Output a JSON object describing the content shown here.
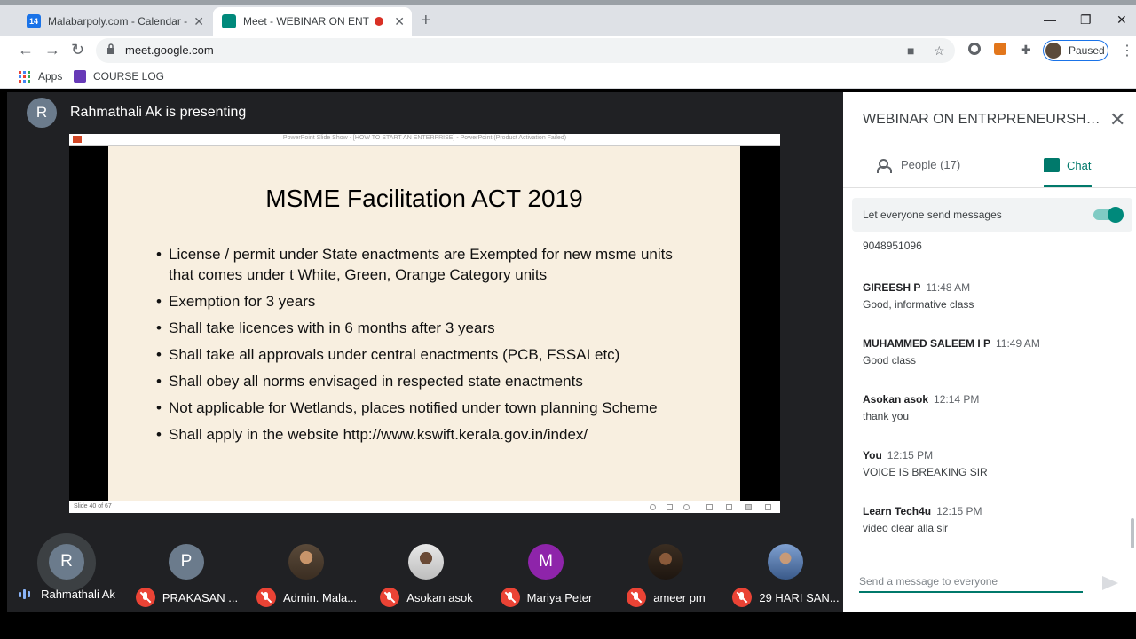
{
  "browser": {
    "tabs": [
      {
        "title": "Malabarpoly.com - Calendar - Sa",
        "favicon_text": "14",
        "favicon_color": "#1a73e8"
      },
      {
        "title": "Meet - WEBINAR ON ENTRP",
        "favicon_color": "#00897b",
        "recording_color": "#d93025"
      }
    ],
    "url": "meet.google.com",
    "profile_status": "Paused",
    "bookmarks": [
      {
        "label": "Apps"
      },
      {
        "label": "COURSE LOG"
      }
    ]
  },
  "meet": {
    "presenter_initial": "R",
    "presenter_text": "Rahmathali Ak is presenting",
    "slide": {
      "title": "MSME Facilitation ACT 2019",
      "bullets": [
        "License / permit under State enactments are Exempted for new msme units that comes under t White, Green, Orange Category units",
        "Exemption for 3 years",
        "Shall take licences with in 6 months after 3 years",
        "Shall take all approvals under central enactments (PCB, FSSAI etc)",
        "Shall obey all norms envisaged in respected state enactments",
        "Not applicable for Wetlands, places notified under town planning Scheme",
        "Shall apply in the website http://www.kswift.kerala.gov.in/index/"
      ],
      "ppt_window_title": "PowerPoint Slide Show - [HOW TO START AN ENTERPRISE] - PowerPoint (Product Activation Failed)",
      "slide_number": "Slide 40 of 67"
    },
    "participants": [
      {
        "initial": "R",
        "name": "Rahmathali Ak",
        "color": "#6b7b8c",
        "speaking": true
      },
      {
        "initial": "P",
        "name": "PRAKASAN ...",
        "color": "#6b7b8c"
      },
      {
        "initial": "",
        "name": "Admin. Mala...",
        "color": "#b5563d"
      },
      {
        "initial": "",
        "name": "Asokan asok",
        "color": "#8a8a8a"
      },
      {
        "initial": "M",
        "name": "Mariya Peter",
        "color": "#8e24aa"
      },
      {
        "initial": "",
        "name": "ameer pm",
        "color": "#3b2e22"
      },
      {
        "initial": "",
        "name": "29 HARI SAN...",
        "color": "#4a6a9a"
      }
    ]
  },
  "panel": {
    "title": "WEBINAR ON ENTRPRENEURSHIP...",
    "people_tab": "People (17)",
    "chat_tab": "Chat",
    "toggle_label": "Let everyone send messages",
    "messages": [
      {
        "sender": "",
        "time": "",
        "text": "9048951096"
      },
      {
        "sender": "GIREESH P",
        "time": "11:48 AM",
        "text": "Good, informative class"
      },
      {
        "sender": "MUHAMMED SALEEM I P",
        "time": "11:49 AM",
        "text": "Good class"
      },
      {
        "sender": "Asokan asok",
        "time": "12:14 PM",
        "text": "thank you"
      },
      {
        "sender": "You",
        "time": "12:15 PM",
        "text": "VOICE IS BREAKING SIR"
      },
      {
        "sender": "Learn Tech4u",
        "time": "12:15 PM",
        "text": "video clear alla sir"
      }
    ],
    "compose_placeholder": "Send a message to everyone"
  }
}
